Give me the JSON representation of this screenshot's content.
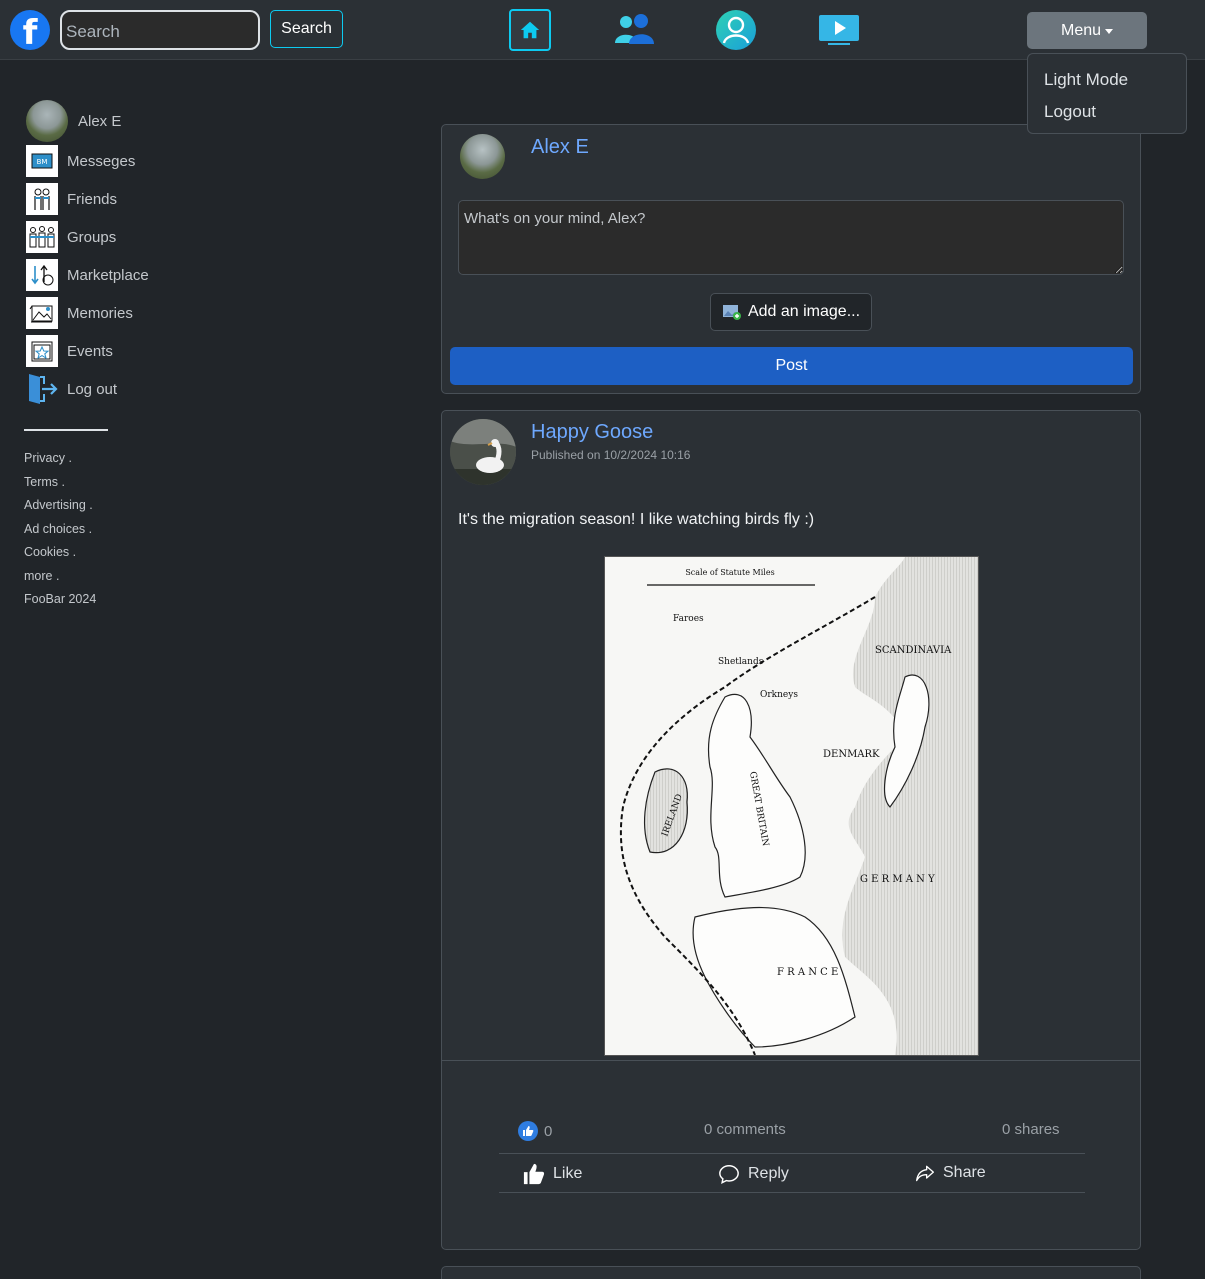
{
  "header": {
    "logo_letter": "f",
    "search_placeholder": "Search",
    "search_button": "Search",
    "nav_icons": [
      "home-icon",
      "friends-icon",
      "profile-icon",
      "watch-icon"
    ],
    "menu_label": "Menu"
  },
  "menu_dropdown": {
    "items": [
      "Light Mode",
      "Logout"
    ]
  },
  "sidebar": {
    "user_name": "Alex E",
    "items": [
      {
        "label": "Messeges",
        "icon": "messages-icon"
      },
      {
        "label": "Friends",
        "icon": "friends-icon"
      },
      {
        "label": "Groups",
        "icon": "groups-icon"
      },
      {
        "label": "Marketplace",
        "icon": "marketplace-icon"
      },
      {
        "label": "Memories",
        "icon": "memories-icon"
      },
      {
        "label": "Events",
        "icon": "events-icon"
      },
      {
        "label": "Log out",
        "icon": "logout-icon"
      }
    ],
    "footer_links": [
      "Privacy .",
      "Terms .",
      "Advertising .",
      "Ad choices .",
      "Cookies .",
      "more ."
    ],
    "copyright": "FooBar 2024"
  },
  "composer": {
    "user_name": "Alex E",
    "placeholder": "What's on your mind, Alex?",
    "add_image_label": "Add an image...",
    "post_button": "Post"
  },
  "post": {
    "author": "Happy Goose",
    "published": "Published on 10/2/2024 10:16",
    "text": "It's the migration season! I like watching birds fly :)",
    "map_labels": {
      "scale": "Scale of Statute Miles",
      "scandinavia": "SCANDINAVIA",
      "denmark": "DENMARK",
      "germany": "G E R M A N Y",
      "france": "F R A N C E",
      "great_britain": "GREAT BRITAIN",
      "ireland": "IRELAND",
      "faroes": "Faroes",
      "shetlands": "Shetlands",
      "orkneys": "Orkneys"
    },
    "likes": "0",
    "comments": "0 comments",
    "shares": "0 shares",
    "actions": {
      "like": "Like",
      "reply": "Reply",
      "share": "Share"
    }
  },
  "colors": {
    "page_bg": "#212529",
    "card_bg": "#2b3035",
    "accent_blue": "#6ea8fe",
    "post_button": "#1d5fc4",
    "info_cyan": "#0dcaf0"
  }
}
